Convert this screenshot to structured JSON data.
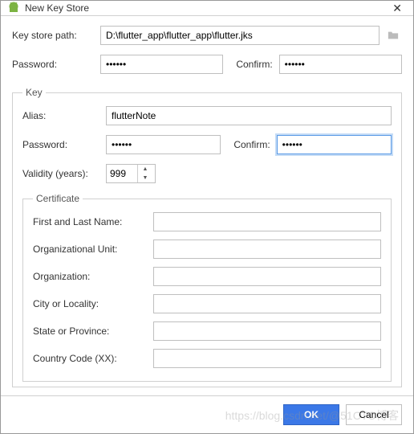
{
  "window": {
    "title": "New Key Store"
  },
  "keystore": {
    "path_label": "Key store path:",
    "path_value": "D:\\flutter_app\\flutter_app\\flutter.jks",
    "password_label": "Password:",
    "password_value": "••••••",
    "confirm_label": "Confirm:",
    "confirm_value": "••••••"
  },
  "key": {
    "legend": "Key",
    "alias_label": "Alias:",
    "alias_value": "flutterNote",
    "password_label": "Password:",
    "password_value": "••••••",
    "confirm_label": "Confirm:",
    "confirm_value": "••••••",
    "validity_label": "Validity (years):",
    "validity_value": "999"
  },
  "certificate": {
    "legend": "Certificate",
    "first_last_label": "First and Last Name:",
    "first_last_value": "",
    "ou_label": "Organizational Unit:",
    "ou_value": "",
    "org_label": "Organization:",
    "org_value": "",
    "city_label": "City or Locality:",
    "city_value": "",
    "state_label": "State or Province:",
    "state_value": "",
    "country_label": "Country Code (XX):",
    "country_value": ""
  },
  "buttons": {
    "ok": "OK",
    "cancel": "Cancel"
  },
  "watermark": "https://blog.csdn.net/@51CTO博客"
}
